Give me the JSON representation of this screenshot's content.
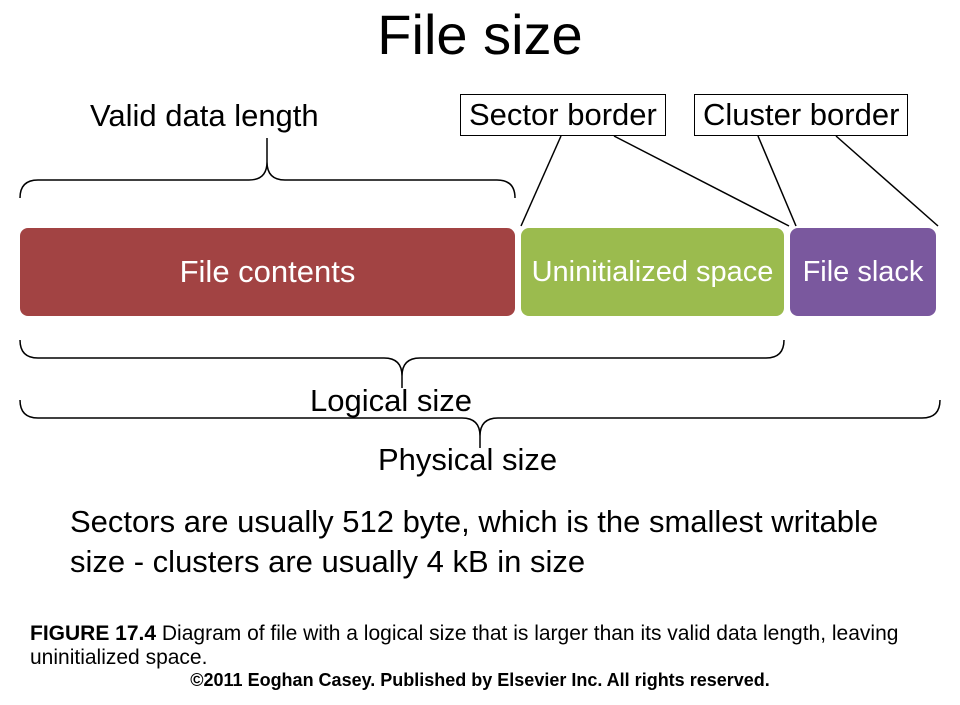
{
  "title": "File size",
  "labels": {
    "valid_data_length": "Valid data length",
    "sector_border": "Sector border",
    "cluster_border": "Cluster border",
    "logical_size": "Logical size",
    "physical_size": "Physical size"
  },
  "segments": {
    "file_contents": "File contents",
    "uninitialized_space": "Uninitialized space",
    "file_slack": "File slack"
  },
  "body_text": "Sectors are usually 512 byte, which is the smallest writable size - clusters are usually 4 kB in size",
  "figure": {
    "label": "FIGURE 17.4",
    "caption": "Diagram of file with a logical size that is larger than its valid data length, leaving uninitialized space."
  },
  "copyright": "©2011 Eoghan Casey. Published by Elsevier Inc. All rights reserved.",
  "chart_data": {
    "type": "bar",
    "title": "File size layout",
    "categories": [
      "File contents",
      "Uninitialized space",
      "File slack"
    ],
    "series": [
      {
        "name": "segment_width_relative",
        "values": [
          495,
          263,
          146
        ]
      }
    ],
    "annotations": {
      "valid_data_length_span": [
        "File contents"
      ],
      "logical_size_span": [
        "File contents",
        "Uninitialized space"
      ],
      "physical_size_span": [
        "File contents",
        "Uninitialized space",
        "File slack"
      ],
      "sector_border_at": "boundary between Uninitialized space and File slack",
      "cluster_border_at": "end of File slack"
    },
    "notes": "Sectors are usually 512 byte; clusters are usually 4 kB"
  }
}
